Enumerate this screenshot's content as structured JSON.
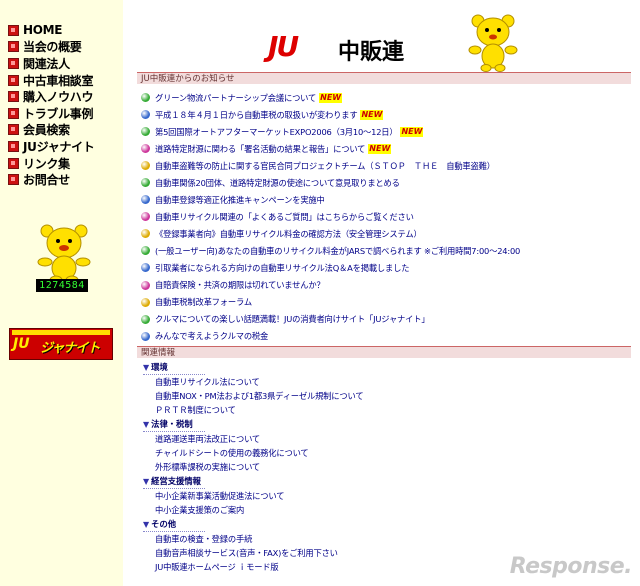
{
  "sidebar": {
    "nav": [
      {
        "label": "HOME"
      },
      {
        "label": "当会の概要"
      },
      {
        "label": "関連法人"
      },
      {
        "label": "中古車相談室"
      },
      {
        "label": "購入ノウハウ"
      },
      {
        "label": "トラブル事例"
      },
      {
        "label": "会員検索"
      },
      {
        "label": "JUジャナイト"
      },
      {
        "label": "リンク集"
      },
      {
        "label": "お問合せ"
      }
    ],
    "counter": "1274584",
    "banner": {
      "logo": "JU",
      "text": "ジャナイト"
    }
  },
  "header": {
    "logo_mark": "JU",
    "logo_text": "中販連"
  },
  "news": {
    "title": "JU中販連からのお知らせ",
    "new_label": "NEW",
    "items": [
      {
        "text": "グリーン物流パートナーシップ会議について",
        "new": true,
        "dot": "#33aa33"
      },
      {
        "text": "平成１８年４月１日から自動車税の取扱いが変わります",
        "new": true,
        "dot": "#3366cc"
      },
      {
        "text": "第5回国際オートアフターマーケットEXPO2006（3月10〜12日）",
        "new": true,
        "dot": "#33aa33"
      },
      {
        "text": "道路特定財源に関わる「署名活動の結果と報告」について",
        "new": true,
        "dot": "#cc3399"
      },
      {
        "text": "自動車盗難等の防止に関する官民合同プロジェクトチーム（ＳＴＯＰ　ＴＨＥ　自動車盗難）",
        "new": false,
        "dot": "#ddaa00"
      },
      {
        "text": "自動車関係20団体、道路特定財源の使途について意見取りまとめる",
        "new": false,
        "dot": "#33aa33"
      },
      {
        "text": "自動車登録等適正化推進キャンペーンを実施中",
        "new": false,
        "dot": "#3366cc"
      },
      {
        "text": "自動車リサイクル関連の「よくあるご質問」はこちらからご覧ください",
        "new": false,
        "dot": "#cc3399"
      },
      {
        "text": "《登録事業者向》自動車リサイクル料金の確認方法（安全管理システム）",
        "new": false,
        "dot": "#ddaa00"
      },
      {
        "text": "(一般ユーザー向)あなたの自動車のリサイクル料金がJARSで調べられます ※ご利用時間7:00〜24:00",
        "new": false,
        "dot": "#33aa33"
      },
      {
        "text": "引取業者になられる方向けの自動車リサイクル法Q＆Aを掲載しました",
        "new": false,
        "dot": "#3366cc"
      },
      {
        "text": "自賠責保険・共済の期限は切れていませんか？",
        "new": false,
        "dot": "#cc3399"
      },
      {
        "text": "自動車税制改革フォーラム",
        "new": false,
        "dot": "#ddaa00"
      },
      {
        "text": "クルマについての楽しい話題満載！JUの消費者向けサイト「JUジャナイト」",
        "new": false,
        "dot": "#33aa33"
      },
      {
        "text": "みんなで考えようクルマの税金",
        "new": false,
        "dot": "#3366cc"
      }
    ]
  },
  "related": {
    "title": "関連情報",
    "categories": [
      {
        "name": "環境",
        "links": [
          "自動車リサイクル法について",
          "自動車NOX・PM法および1都3県ディーゼル規制について",
          "ＰＲＴＲ制度について"
        ]
      },
      {
        "name": "法律・税制",
        "links": [
          "道路運送車両法改正について",
          "チャイルドシートの使用の義務化について",
          "外形標準課税の実施について"
        ]
      },
      {
        "name": "経営支援情報",
        "links": [
          "中小企業新事業活動促進法について",
          "中小企業支援策のご案内"
        ]
      },
      {
        "name": "その他",
        "links": [
          "自動車の検査・登録の手続",
          "自動音声相談サービス(音声・FAX)をご利用下さい",
          "JU中販連ホームページ ｉモード版"
        ]
      }
    ]
  },
  "watermark": "Response."
}
